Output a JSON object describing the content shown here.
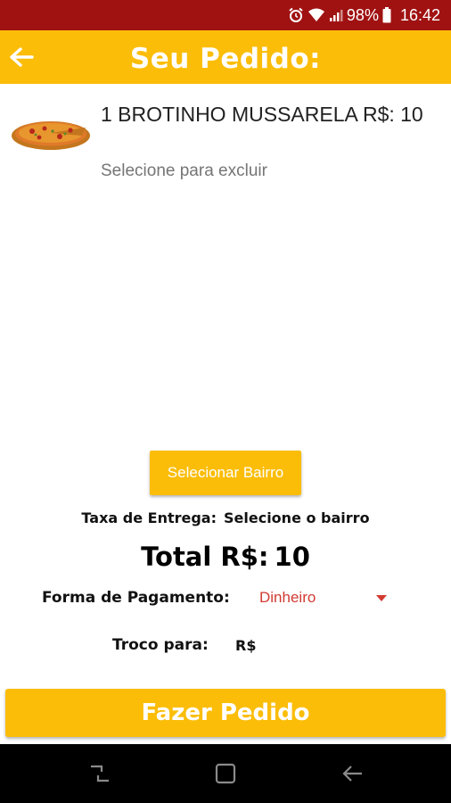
{
  "status_bar": {
    "battery": "98%",
    "time": "16:42",
    "icons": [
      "alarm-icon",
      "wifi-icon",
      "signal-icon",
      "battery-icon"
    ]
  },
  "header": {
    "title": "Seu Pedido:",
    "back_icon": "arrow-left-icon",
    "color": "#fbbd08"
  },
  "order": {
    "items": [
      {
        "name": "1 BROTINHO MUSSARELA R$: 10",
        "hint": "Selecione para excluir",
        "image": "pizza-thumbnail"
      }
    ]
  },
  "delivery": {
    "select_button": "Selecionar Bairro",
    "fee_label": "Taxa de Entrega:",
    "fee_value": "Selecione o bairro"
  },
  "total": {
    "label": "Total R$:",
    "value": "10"
  },
  "payment": {
    "label": "Forma de Pagamento:",
    "selected": "Dinheiro"
  },
  "change": {
    "label": "Troco para:",
    "placeholder": "R$"
  },
  "submit_button": "Fazer Pedido",
  "colors": {
    "status_bar": "#a01212",
    "accent": "#fbbd08",
    "select_text": "#d23a32"
  }
}
